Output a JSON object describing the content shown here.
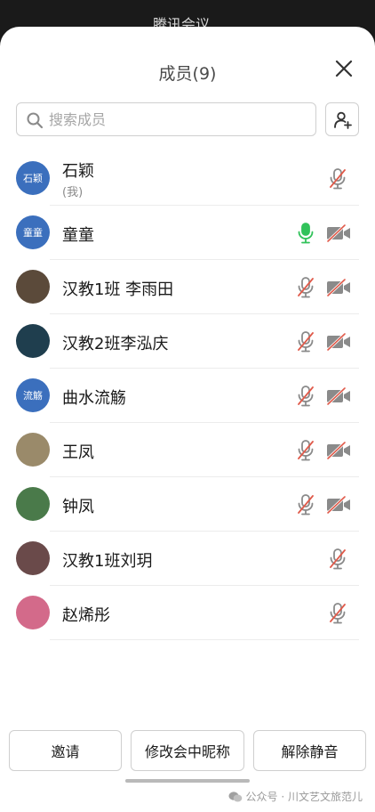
{
  "app": {
    "title": "腾讯会议"
  },
  "panel": {
    "title": "成员(9)"
  },
  "search": {
    "placeholder": "搜索成员",
    "value": ""
  },
  "colors": {
    "accent": "#3b6fbd",
    "mic_on": "#31c25a",
    "muted": "#e05a4a",
    "icon_gray": "#8a8a8a"
  },
  "members": [
    {
      "name": "石颖",
      "sub": "(我)",
      "avatar_text": "石颖",
      "avatar_color": "#3b6fbd",
      "mic": "muted",
      "camera": "none"
    },
    {
      "name": "童童",
      "sub": "",
      "avatar_text": "童童",
      "avatar_color": "#3b6fbd",
      "mic": "on",
      "camera": "off"
    },
    {
      "name": "汉教1班 李雨田",
      "sub": "",
      "avatar_text": "",
      "avatar_color": "#5b4a3a",
      "mic": "muted",
      "camera": "off"
    },
    {
      "name": "汉教2班李泓庆",
      "sub": "",
      "avatar_text": "",
      "avatar_color": "#1f3e4e",
      "mic": "muted",
      "camera": "off"
    },
    {
      "name": "曲水流觞",
      "sub": "",
      "avatar_text": "流觞",
      "avatar_color": "#3b6fbd",
      "mic": "muted",
      "camera": "off"
    },
    {
      "name": "王凤",
      "sub": "",
      "avatar_text": "",
      "avatar_color": "#9a8a6a",
      "mic": "muted",
      "camera": "off"
    },
    {
      "name": "钟凤",
      "sub": "",
      "avatar_text": "",
      "avatar_color": "#4a7a4a",
      "mic": "muted",
      "camera": "off"
    },
    {
      "name": "汉教1班刘玥",
      "sub": "",
      "avatar_text": "",
      "avatar_color": "#6a4a4a",
      "mic": "muted",
      "camera": "none"
    },
    {
      "name": "赵烯彤",
      "sub": "",
      "avatar_text": "",
      "avatar_color": "#d36a8a",
      "mic": "muted",
      "camera": "none"
    }
  ],
  "actions": {
    "invite": "邀请",
    "rename": "修改会中昵称",
    "unmute": "解除静音"
  },
  "watermark": {
    "text": "公众号 · 川文艺文旅范儿"
  }
}
